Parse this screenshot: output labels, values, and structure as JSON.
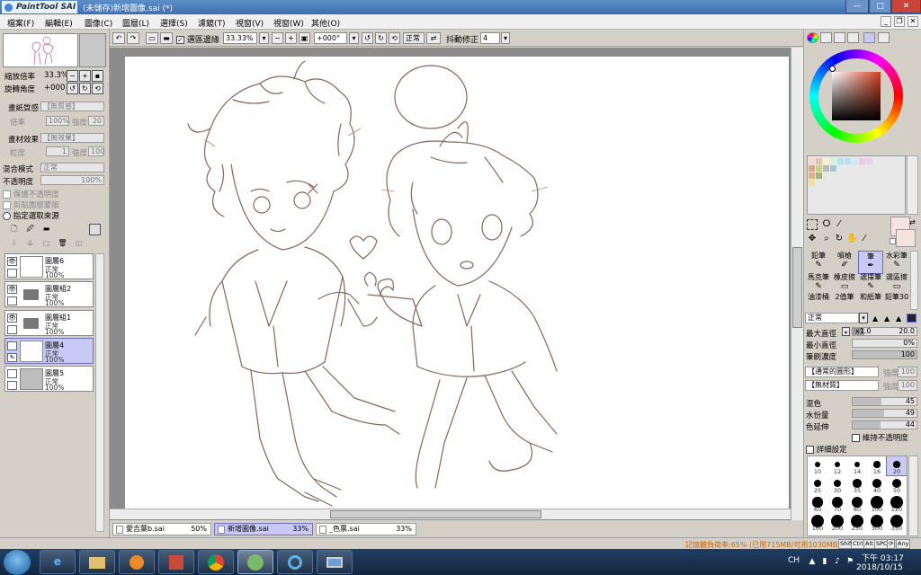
{
  "app": {
    "logo": "PaintTool SAI",
    "title": "(未儲存)新增圖像.sai (*)",
    "window_buttons": {
      "min": "—",
      "max": "□",
      "close": "✕"
    }
  },
  "menu": {
    "items": [
      "檔案(F)",
      "編輯(E)",
      "圖像(C)",
      "圖層(L)",
      "選擇(S)",
      "濾鏡(T)",
      "視窗(V)",
      "視窗(W)",
      "其他(O)"
    ],
    "mdi": {
      "min": "_",
      "restore": "❐",
      "close": "✕"
    }
  },
  "toolbar": {
    "selection_label": "選區邊緣",
    "selection_checked": true,
    "zoom": "33.33%",
    "rotation": "+000°",
    "blend_mode": "正常",
    "stabilizer_label": "抖動修正",
    "stabilizer_value": "4"
  },
  "navigator": {
    "zoom_label": "縮放倍率",
    "zoom_value": "33.3%",
    "rotate_label": "旋轉角度",
    "rotate_value": "+000"
  },
  "properties": {
    "paper_texture_label": "畫紙質感",
    "paper_texture_value": "【無質感】",
    "scale_label": "倍率",
    "scale_value": "100%",
    "strength_label": "強度",
    "strength_value": "20",
    "material_effect_label": "畫材效果",
    "material_effect_value": "【無效果】",
    "grain_label": "粒度",
    "grain_value": "1",
    "intensity_label": "強度",
    "intensity_value": "100",
    "blend_mode_label": "混合模式",
    "blend_mode_value": "正常",
    "opacity_label": "不透明度",
    "opacity_value": "100%",
    "protect_opacity": "保護不透明度",
    "clip_layer": "剪貼圖層蒙版",
    "selection_source": "指定選取來源"
  },
  "layers": [
    {
      "name": "圖層6",
      "mode": "正常",
      "opacity": "100%",
      "kind": "layer",
      "visible": true,
      "selected": false
    },
    {
      "name": "圖層組2",
      "mode": "正常",
      "opacity": "100%",
      "kind": "folder",
      "visible": true,
      "selected": false
    },
    {
      "name": "圖層組1",
      "mode": "正常",
      "opacity": "100%",
      "kind": "folder",
      "visible": true,
      "selected": false
    },
    {
      "name": "圖層4",
      "mode": "正常",
      "opacity": "100%",
      "kind": "layer",
      "visible": false,
      "selected": true
    },
    {
      "name": "圖層5",
      "mode": "正常",
      "opacity": "100%",
      "kind": "gray",
      "visible": false,
      "selected": false
    }
  ],
  "doc_tabs": [
    {
      "name": "愛吉葉b.sai",
      "zoom": "50%",
      "active": false
    },
    {
      "name": "新增圖像.sai",
      "zoom": "33%",
      "active": true
    },
    {
      "name": "_色票.sai",
      "zoom": "33%",
      "active": false
    }
  ],
  "tools": {
    "row1": [
      "鉛筆",
      "噴槍",
      "筆",
      "水彩筆"
    ],
    "row2": [
      "馬克筆",
      "橡皮擦",
      "選擇筆",
      "選區擦"
    ],
    "row3": [
      "油漆桶",
      "2值筆",
      "和紙筆",
      "鉛筆30"
    ],
    "selected": "筆"
  },
  "brush": {
    "mode": "正常",
    "max_size_label": "最大直徑",
    "max_size_mult": "x1.0",
    "max_size_value": "20.0",
    "min_size_label": "最小直徑",
    "min_size_value": "0%",
    "density_label": "筆刷濃度",
    "density_value": "100",
    "shape_value": "【通常的圓形】",
    "shape_strength_label": "強度",
    "shape_strength_value": "100",
    "texture_value": "【無材質】",
    "texture_strength_label": "強度",
    "texture_strength_value": "100",
    "blending_label": "混色",
    "blending_value": "45",
    "dilution_label": "水份量",
    "dilution_value": "49",
    "persistence_label": "色延伸",
    "persistence_value": "44",
    "keep_opacity": "維持不透明度",
    "detail_settings": "詳細設定",
    "sizes": [
      "10",
      "12",
      "14",
      "16",
      "20",
      "25",
      "30",
      "35",
      "40",
      "50",
      "60",
      "70",
      "80",
      "100",
      "120",
      "160",
      "200",
      "250",
      "300",
      "350"
    ],
    "selected_size": "20"
  },
  "status": {
    "memory": "記憶體負荷率:65% (已用715MB/可用1030MB)",
    "keys": [
      "Shift",
      "Ctrl",
      "Alt",
      "SPC",
      "⟳",
      "Any"
    ]
  },
  "taskbar": {
    "apps": [
      "start",
      "internet-explorer",
      "file-explorer",
      "media-player",
      "game",
      "chrome",
      "paint-tool-sai",
      "ie-refresh",
      "remote-desktop"
    ],
    "lang": "CH",
    "time": "下午 03:17",
    "date": "2018/10/15"
  },
  "colors": {
    "accent": "#c9c9f5",
    "foreground_swatch": "#f5e3df",
    "sketch_line": "#8a6458"
  }
}
